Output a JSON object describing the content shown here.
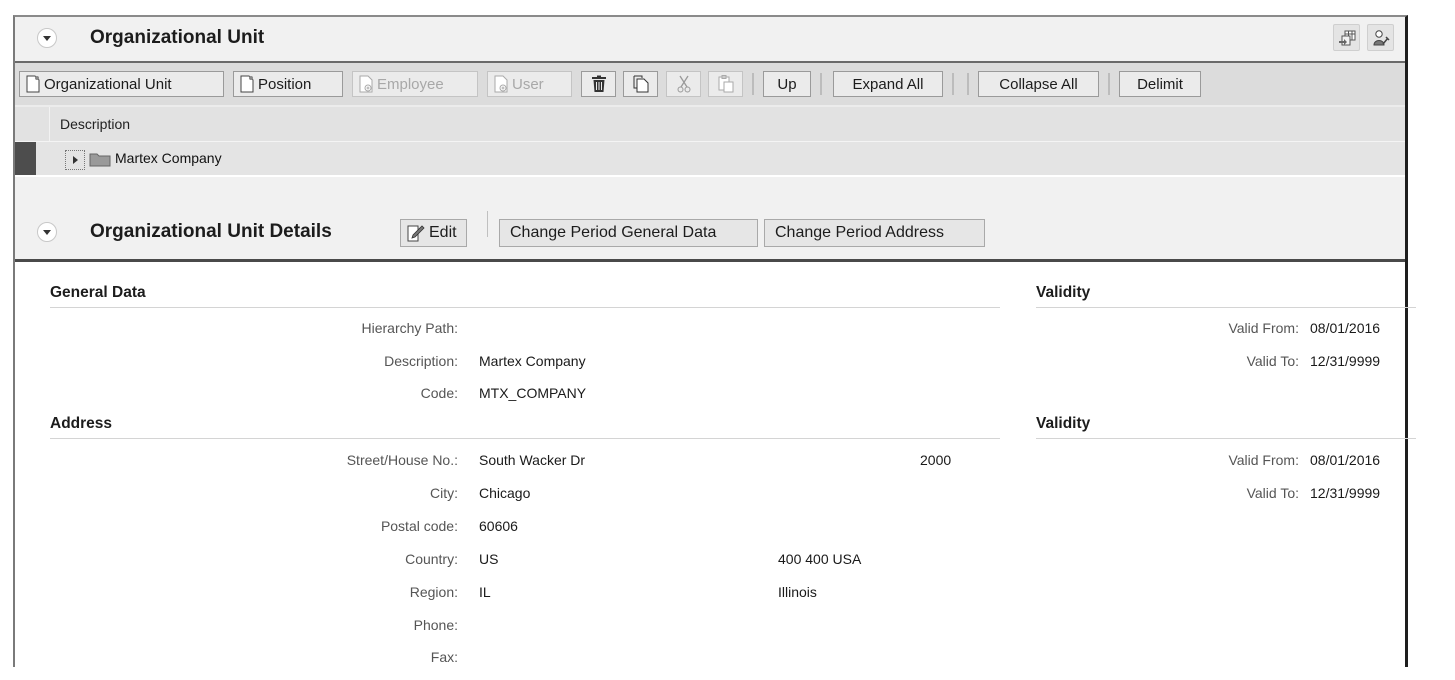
{
  "org_unit_panel": {
    "title": "Organizational Unit",
    "header_icons": [
      {
        "name": "table-settings-icon"
      },
      {
        "name": "user-settings-icon"
      }
    ]
  },
  "toolbar": {
    "buttons": [
      {
        "label": "Organizational Unit",
        "icon": "new-document-icon",
        "enabled": true
      },
      {
        "label": "Position",
        "icon": "new-document-icon",
        "enabled": true
      },
      {
        "label": "Employee",
        "icon": "add-document-icon",
        "enabled": false
      },
      {
        "label": "User",
        "icon": "add-document-icon",
        "enabled": false
      },
      {
        "label": "",
        "icon": "trash-icon",
        "enabled": true
      },
      {
        "label": "",
        "icon": "copy-icon",
        "enabled": true
      },
      {
        "label": "",
        "icon": "cut-icon",
        "enabled": false
      },
      {
        "label": "",
        "icon": "paste-icon",
        "enabled": false
      },
      {
        "label": "Up",
        "enabled": true
      },
      {
        "label": "Expand All",
        "enabled": true
      },
      {
        "label": "Collapse All",
        "enabled": true
      },
      {
        "label": "Delimit",
        "enabled": true
      }
    ]
  },
  "tree": {
    "column_header": "Description",
    "rows": [
      {
        "label": "Martex Company",
        "expanded": false,
        "selected": true
      }
    ]
  },
  "details_panel": {
    "title": "Organizational Unit Details",
    "edit_label": "Edit",
    "change_general_label": "Change Period General Data",
    "change_address_label": "Change Period Address"
  },
  "general_data": {
    "title": "General Data",
    "fields": [
      {
        "label": "Hierarchy Path:",
        "value": ""
      },
      {
        "label": "Description:",
        "value": "Martex Company"
      },
      {
        "label": "Code:",
        "value": "MTX_COMPANY"
      }
    ],
    "validity": {
      "title": "Validity",
      "valid_from_label": "Valid From:",
      "valid_from": "08/01/2016",
      "valid_to_label": "Valid To:",
      "valid_to": "12/31/9999"
    }
  },
  "address": {
    "title": "Address",
    "fields": [
      {
        "label": "Street/House No.:",
        "value": "South Wacker Dr",
        "extra": "2000"
      },
      {
        "label": "City:",
        "value": "Chicago",
        "extra": ""
      },
      {
        "label": "Postal code:",
        "value": "60606",
        "extra": ""
      },
      {
        "label": "Country:",
        "value": "US",
        "extra": "400 400 USA"
      },
      {
        "label": "Region:",
        "value": "IL",
        "extra": "Illinois"
      },
      {
        "label": "Phone:",
        "value": "",
        "extra": ""
      },
      {
        "label": "Fax:",
        "value": "",
        "extra": ""
      }
    ],
    "validity": {
      "title": "Validity",
      "valid_from_label": "Valid From:",
      "valid_from": "08/01/2016",
      "valid_to_label": "Valid To:",
      "valid_to": "12/31/9999"
    }
  }
}
